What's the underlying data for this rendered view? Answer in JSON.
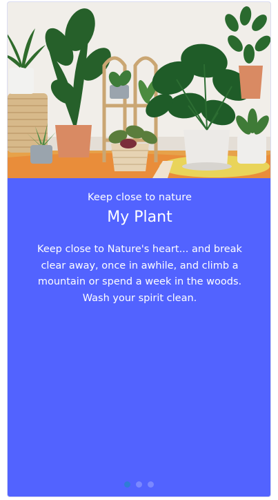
{
  "onboarding": {
    "subtitle": "Keep close to nature",
    "title": "My Plant",
    "description": "Keep close to Nature's heart... and break clear away, once in awhile, and climb a mountain or spend a week in the woods. Wash your spirit clean."
  },
  "pagination": {
    "page_count": 3,
    "active_index": 0
  },
  "colors": {
    "card_background": "#5263ff",
    "active_dot": "#2f7dd6",
    "inactive_dot": "#7b88ff"
  }
}
